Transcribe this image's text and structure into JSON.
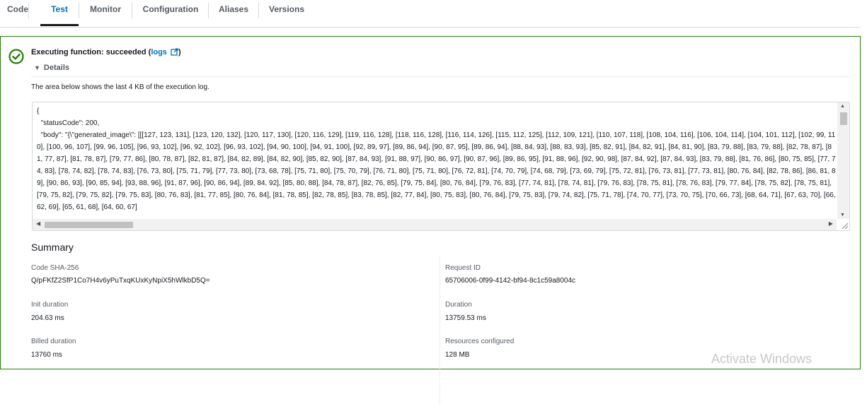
{
  "tabs": [
    {
      "label": "Code"
    },
    {
      "label": "Test"
    },
    {
      "label": "Monitor"
    },
    {
      "label": "Configuration"
    },
    {
      "label": "Aliases"
    },
    {
      "label": "Versions"
    }
  ],
  "execution": {
    "status_text": "Executing function: succeeded (",
    "logs_link": "logs",
    "close_paren": ")",
    "details_label": "Details",
    "description": "The area below shows the last 4 KB of the execution log.",
    "log_text": "{\n  \"statusCode\": 200,\n  \"body\": \"{\\\"generated_image\\\": [[[127, 123, 131], [123, 120, 132], [120, 117, 130], [120, 116, 129], [119, 116, 128], [118, 116, 128], [116, 114, 126], [115, 112, 125], [112, 109, 121], [110, 107, 118], [108, 104, 116], [106, 104, 114], [104, 101, 112], [102, 99, 110], [100, 96, 107], [99, 96, 105], [96, 93, 102], [96, 92, 102], [96, 93, 102], [94, 90, 100], [94, 91, 100], [92, 89, 97], [89, 86, 94], [90, 87, 95], [89, 86, 94], [88, 84, 93], [88, 83, 93], [85, 82, 91], [84, 82, 91], [84, 81, 90], [83, 79, 88], [83, 79, 88], [82, 78, 87], [81, 77, 87], [81, 78, 87], [79, 77, 86], [80, 78, 87], [82, 81, 87], [84, 82, 89], [84, 82, 90], [85, 82, 90], [87, 84, 93], [91, 88, 97], [90, 86, 97], [90, 87, 96], [89, 86, 95], [91, 88, 96], [92, 90, 98], [87, 84, 92], [87, 84, 93], [83, 79, 88], [81, 76, 86], [80, 75, 85], [77, 74, 83], [78, 74, 82], [78, 74, 83], [76, 73, 80], [75, 71, 79], [77, 73, 80], [73, 68, 78], [75, 71, 80], [75, 70, 79], [76, 71, 80], [75, 71, 80], [76, 72, 81], [74, 70, 79], [74, 68, 79], [73, 69, 79], [75, 72, 81], [76, 73, 81], [77, 73, 81], [80, 76, 84], [82, 78, 86], [86, 81, 89], [90, 86, 93], [90, 85, 94], [93, 88, 96], [91, 87, 96], [90, 86, 94], [89, 84, 92], [85, 80, 88], [84, 78, 87], [82, 76, 85], [79, 75, 84], [80, 76, 84], [79, 76, 83], [77, 74, 81], [78, 74, 81], [79, 76, 83], [78, 75, 81], [78, 76, 83], [79, 77, 84], [78, 75, 82], [78, 75, 81], [79, 75, 82], [79, 75, 82], [79, 75, 83], [80, 76, 83], [81, 77, 85], [80, 76, 84], [81, 78, 85], [82, 78, 85], [83, 78, 85], [82, 77, 84], [80, 75, 83], [80, 76, 84], [79, 75, 83], [79, 74, 82], [75, 71, 78], [74, 70, 77], [73, 70, 75], [70, 66, 73], [68, 64, 71], [67, 63, 70], [66, 62, 69], [65, 61, 68], [64, 60, 67]"
  },
  "summary": {
    "title": "Summary",
    "fields": {
      "code_sha_label": "Code SHA-256",
      "code_sha_value": "Q/pFKfZ2SfP1Co7H4v6yPuTxqKUxKyNpiX5hWlkbD5Q=",
      "request_id_label": "Request ID",
      "request_id_value": "65706006-0f99-4142-bf94-8c1c59a8004c",
      "init_duration_label": "Init duration",
      "init_duration_value": "204.63 ms",
      "duration_label": "Duration",
      "duration_value": "13759.53 ms",
      "billed_duration_label": "Billed duration",
      "billed_duration_value": "13760 ms",
      "resources_label": "Resources configured",
      "resources_value": "128 MB"
    }
  },
  "watermark": "Activate Windows",
  "colors": {
    "success": "#1d8102",
    "link": "#0073bb"
  }
}
